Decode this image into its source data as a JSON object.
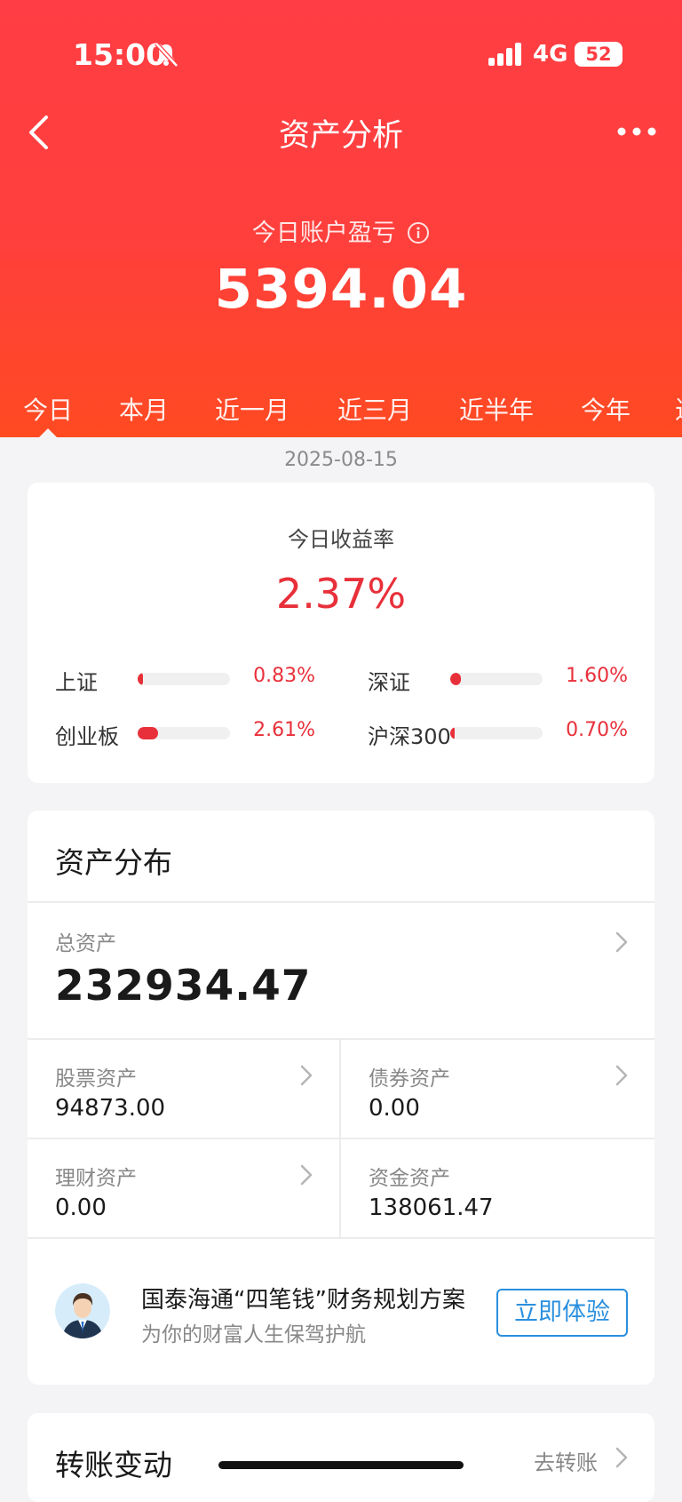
{
  "status_bar": {
    "time": "15:00",
    "network": "4G",
    "battery": "52"
  },
  "nav": {
    "title": "资产分析"
  },
  "summary": {
    "pnl_label": "今日账户盈亏",
    "pnl_value": "5394.04"
  },
  "tabs": [
    "今日",
    "本月",
    "近一月",
    "近三月",
    "近半年",
    "今年",
    "近"
  ],
  "active_tab": "今日",
  "date": "2025-08-15",
  "return_card": {
    "label": "今日收益率",
    "value": "2.37%",
    "indices": [
      {
        "name": "上证",
        "value": "0.83%",
        "level": 0.06
      },
      {
        "name": "深证",
        "value": "1.60%",
        "level": 0.12
      },
      {
        "name": "创业板",
        "value": "2.61%",
        "level": 0.22
      },
      {
        "name": "沪深300",
        "value": "0.70%",
        "level": 0.05
      }
    ]
  },
  "assets": {
    "title": "资产分布",
    "total_label": "总资产",
    "total_value": "232934.47",
    "items": [
      {
        "label": "股票资产",
        "value": "94873.00"
      },
      {
        "label": "债券资产",
        "value": "0.00"
      },
      {
        "label": "理财资产",
        "value": "0.00"
      },
      {
        "label": "资金资产",
        "value": "138061.47"
      }
    ],
    "promo": {
      "title": "国泰海通“四笔钱”财务规划方案",
      "subtitle": "为你的财富人生保驾护航",
      "button": "立即体验"
    }
  },
  "transfer": {
    "title": "转账变动",
    "link": "去转账"
  },
  "colors": {
    "header": "#ff3d44",
    "positive": "#e8303a",
    "link": "#2a8fde"
  }
}
